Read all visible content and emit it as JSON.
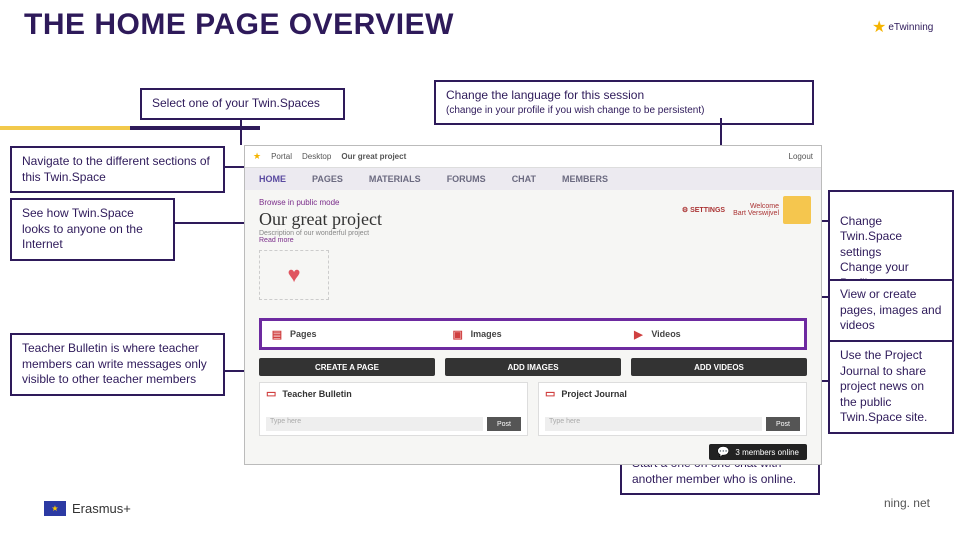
{
  "title": "THE HOME PAGE OVERVIEW",
  "logo_label": "eTwinning",
  "callouts": {
    "select_space": "Select one of your Twin.Spaces",
    "change_lang_main": "Change the language for this session",
    "change_lang_sub": "(change in your profile if you wish change to be persistent)",
    "navigate": "Navigate to the different sections of this Twin.Space",
    "public_view": "See how Twin.Space looks to anyone on the Internet",
    "settings": "Change Twin.Space settings\nChange your Profile\nCheck your Twin.Mail",
    "media": "View or create pages, images and videos",
    "bulletin": "Teacher Bulletin is where teacher members can write messages only visible to other teacher members",
    "journal": "Use the Project Journal to share project news on the public Twin.Space site.",
    "chat": "Start a one on one chat with another member who is online."
  },
  "screenshot": {
    "topbar": {
      "portal": "Portal",
      "desktop": "Desktop",
      "project": "Our great project",
      "logout": "Logout"
    },
    "nav": [
      "HOME",
      "PAGES",
      "MATERIALS",
      "FORUMS",
      "CHAT",
      "MEMBERS"
    ],
    "browse": "Browse in public mode",
    "project_title": "Our great project",
    "project_sub": "Description of our wonderful project",
    "read_more": "Read more",
    "settings_label": "SETTINGS",
    "welcome": "Welcome",
    "user": "Bart Verswijvel",
    "media": {
      "pages": "Pages",
      "images": "Images",
      "videos": "Videos"
    },
    "create": {
      "page": "CREATE A PAGE",
      "images": "ADD IMAGES",
      "videos": "ADD VIDEOS"
    },
    "bulletin": {
      "teacher": "Teacher Bulletin",
      "journal": "Project Journal",
      "placeholder": "Type here",
      "post": "Post"
    },
    "chat": "3 members online"
  },
  "footer": {
    "erasmus": "Erasmus+",
    "url": "ning. net"
  }
}
